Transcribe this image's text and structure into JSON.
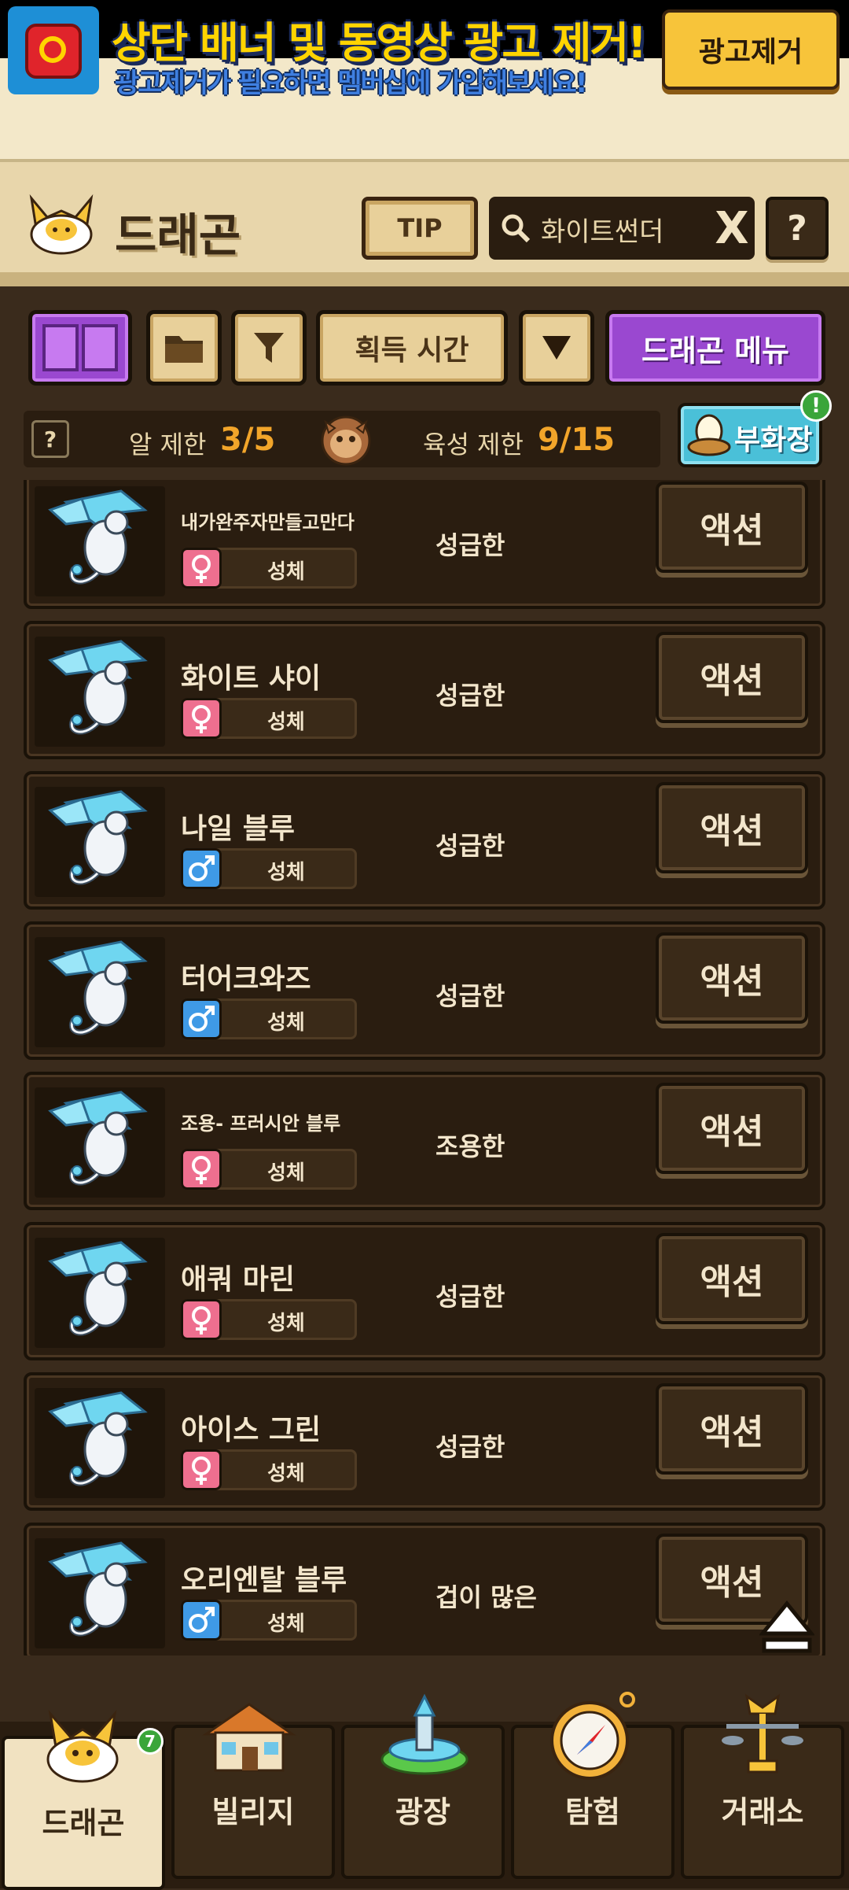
{
  "ad": {
    "title": "상단 배너 및 동영상 광고 제거!",
    "subtitle": "광고제거가 필요하면 멤버십에 가입해보세요!",
    "remove_button": "광고제거"
  },
  "header": {
    "title": "드래곤",
    "tip_label": "TIP",
    "search_value": "화이트썬더",
    "clear_label": "X",
    "help_label": "?"
  },
  "toolbar": {
    "sort_label": "획득 시간",
    "menu_label": "드래곤 메뉴"
  },
  "limits": {
    "help_label": "?",
    "egg_label": "알 제한",
    "egg_value": "3/5",
    "raise_label": "육성 제한",
    "raise_value": "9/15",
    "hatchery_label": "부화장",
    "hatchery_alert": "!"
  },
  "dragons": [
    {
      "name": "내가완주자만들고만다",
      "gender": "female",
      "stage": "성체",
      "personality": "성급한",
      "action": "액션"
    },
    {
      "name": "화이트 샤이",
      "gender": "female",
      "stage": "성체",
      "personality": "성급한",
      "action": "액션"
    },
    {
      "name": "나일 블루",
      "gender": "male",
      "stage": "성체",
      "personality": "성급한",
      "action": "액션"
    },
    {
      "name": "터어크와즈",
      "gender": "male",
      "stage": "성체",
      "personality": "성급한",
      "action": "액션"
    },
    {
      "name": "조용- 프러시안 블루",
      "gender": "female",
      "stage": "성체",
      "personality": "조용한",
      "action": "액션"
    },
    {
      "name": "애쿼 마린",
      "gender": "female",
      "stage": "성체",
      "personality": "성급한",
      "action": "액션"
    },
    {
      "name": "아이스 그린",
      "gender": "female",
      "stage": "성체",
      "personality": "성급한",
      "action": "액션"
    },
    {
      "name": "오리엔탈 블루",
      "gender": "male",
      "stage": "성체",
      "personality": "겁이 많은",
      "action": "액션"
    }
  ],
  "nav": {
    "tabs": [
      {
        "label": "드래곤",
        "icon": "dragon-icon",
        "active": true,
        "badge": "7"
      },
      {
        "label": "빌리지",
        "icon": "house-icon"
      },
      {
        "label": "광장",
        "icon": "fountain-icon"
      },
      {
        "label": "탐험",
        "icon": "compass-icon"
      },
      {
        "label": "거래소",
        "icon": "scale-icon"
      }
    ]
  },
  "colors": {
    "background": "#3a2b1c",
    "accent_purple": "#9a48d0",
    "orange_value": "#f2a52a",
    "female": "#ee6f8f",
    "male": "#3f9ae6"
  }
}
